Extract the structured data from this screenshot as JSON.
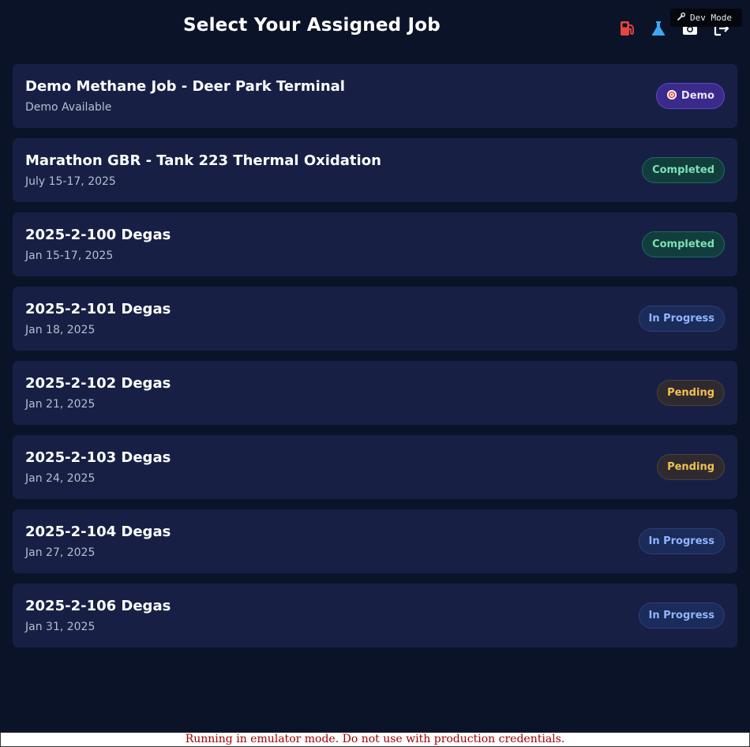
{
  "header": {
    "title": "Select Your Assigned Job",
    "icons": [
      "fuel-icon",
      "flask-icon",
      "camera-icon",
      "logout-icon"
    ],
    "dev_badge": "Dev Mode"
  },
  "colors": {
    "background": "#0b1328",
    "card": "#172044",
    "fuel_icon": "#e8453c",
    "flask_icon": "#3fa7f5",
    "demo": "#5c48c8",
    "completed": "#7fe0b5",
    "in_progress": "#8fb6ff",
    "pending": "#f2c14e",
    "warning_text": "#a00000"
  },
  "jobs": [
    {
      "title": "Demo Methane Job - Deer Park Terminal",
      "date": "Demo Available",
      "status": "Demo",
      "status_icon": "target-icon"
    },
    {
      "title": "Marathon GBR - Tank 223 Thermal Oxidation",
      "date": "July 15-17, 2025",
      "status": "Completed"
    },
    {
      "title": "2025-2-100 Degas",
      "date": "Jan 15-17, 2025",
      "status": "Completed"
    },
    {
      "title": "2025-2-101 Degas",
      "date": "Jan 18, 2025",
      "status": "In Progress"
    },
    {
      "title": "2025-2-102 Degas",
      "date": "Jan 21, 2025",
      "status": "Pending"
    },
    {
      "title": "2025-2-103 Degas",
      "date": "Jan 24, 2025",
      "status": "Pending"
    },
    {
      "title": "2025-2-104 Degas",
      "date": "Jan 27, 2025",
      "status": "In Progress"
    },
    {
      "title": "2025-2-106 Degas",
      "date": "Jan 31, 2025",
      "status": "In Progress"
    }
  ],
  "footer": {
    "warning": "Running in emulator mode. Do not use with production credentials."
  }
}
